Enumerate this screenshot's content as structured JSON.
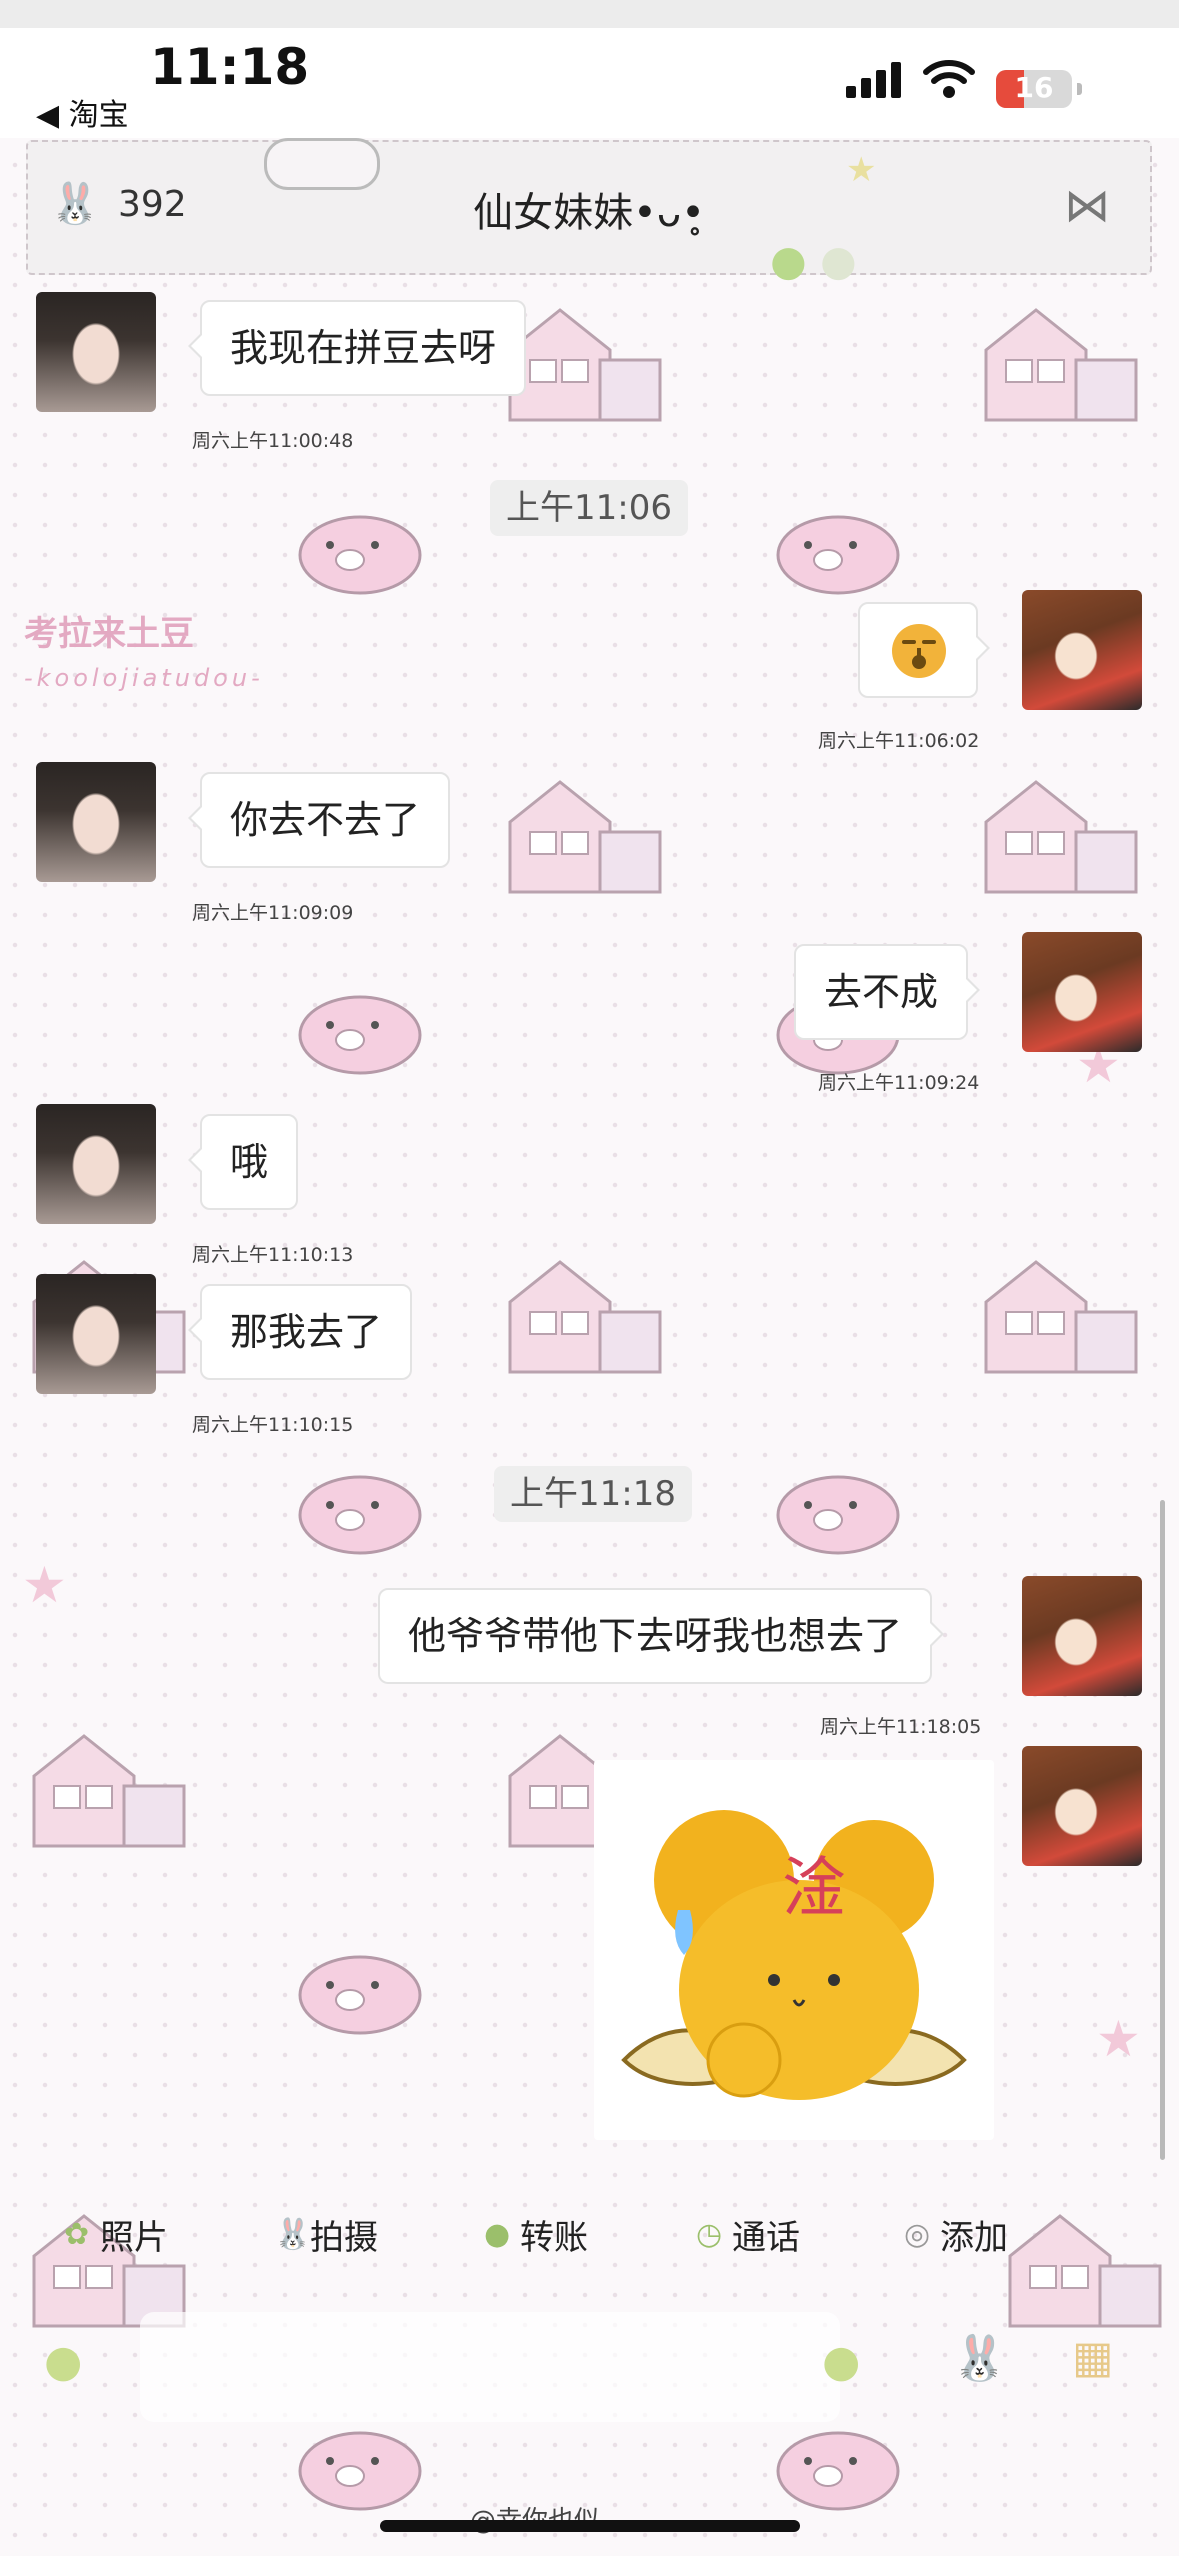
{
  "status_bar": {
    "time": "11:18",
    "back_app": "淘宝",
    "battery": "16"
  },
  "header": {
    "count": "392",
    "title": "仙女妹妹•ᴗ•̥"
  },
  "stickers": {
    "brand_cn": "考拉来土豆",
    "brand_en": "-koolojiatudou-"
  },
  "messages": [
    {
      "side": "left",
      "text": "我现在拼豆去呀",
      "time": "周六上午11:00:48"
    },
    {
      "divider": "上午11:06"
    },
    {
      "side": "right",
      "type": "emoji",
      "emoji": "sleepy-face",
      "time": "周六上午11:06:02"
    },
    {
      "side": "left",
      "text": "你去不去了",
      "time": "周六上午11:09:09"
    },
    {
      "side": "right",
      "text": "去不成",
      "time": "周六上午11:09:24"
    },
    {
      "side": "left",
      "text": "哦",
      "time": "周六上午11:10:13"
    },
    {
      "side": "left",
      "text": "那我去了",
      "time": "周六上午11:10:15"
    },
    {
      "divider": "上午11:18"
    },
    {
      "side": "right",
      "text": "他爷爷带他下去呀我也想去了",
      "time": "周六上午11:18:05"
    },
    {
      "side": "right",
      "type": "sticker",
      "sticker_text": "淦"
    }
  ],
  "toolbar": {
    "photo": "照片",
    "camera": "拍摄",
    "transfer": "转账",
    "call": "通话",
    "add": "添加"
  },
  "watermark": "@幸你也似"
}
